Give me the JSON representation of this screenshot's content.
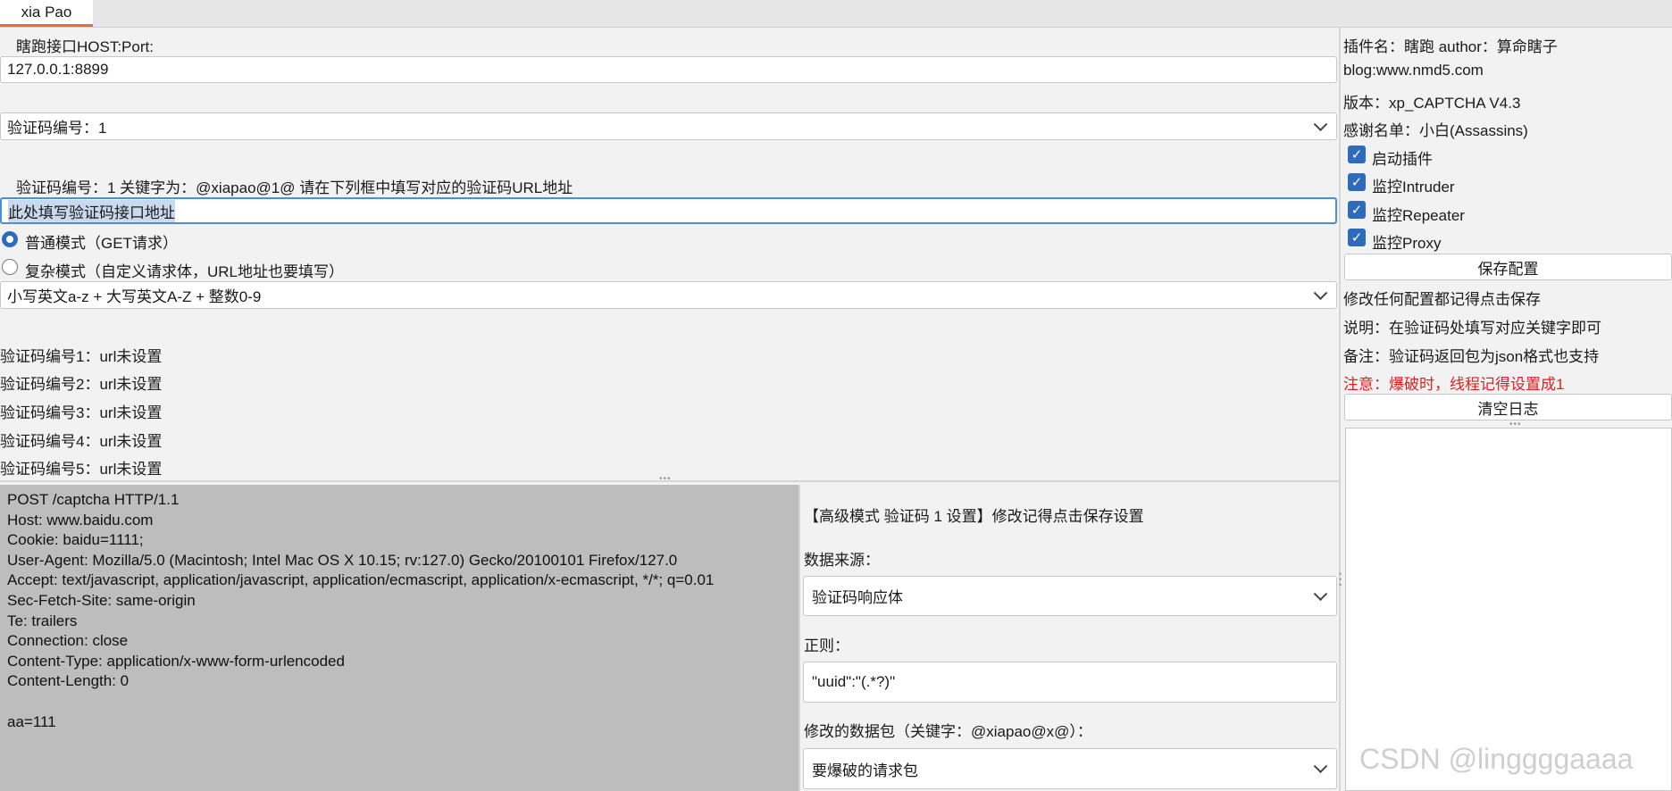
{
  "tab": {
    "label": "xia Pao"
  },
  "left": {
    "host_label": "瞎跑接口HOST:Port:",
    "host_value": "127.0.0.1:8899",
    "captcha_select": "验证码编号：1",
    "keyword_hint": "验证码编号：1  关键字为：@xiapao@1@     请在下列框中填写对应的验证码URL地址",
    "url_placeholder_value": "此处填写验证码接口地址",
    "radio_normal": "普通模式（GET请求）",
    "radio_complex": "复杂模式（自定义请求体，URL地址也要填写）",
    "charset_select": "小写英文a-z + 大写英文A-Z + 整数0-9",
    "status_list": [
      "验证码编号1：url未设置",
      "验证码编号2：url未设置",
      "验证码编号3：url未设置",
      "验证码编号4：url未设置",
      "验证码编号5：url未设置"
    ]
  },
  "request_editor": {
    "content": "POST /captcha HTTP/1.1\nHost: www.baidu.com\nCookie: baidu=1111;\nUser-Agent: Mozilla/5.0 (Macintosh; Intel Mac OS X 10.15; rv:127.0) Gecko/20100101 Firefox/127.0\nAccept: text/javascript, application/javascript, application/ecmascript, application/x-ecmascript, */*; q=0.01\nSec-Fetch-Site: same-origin\nTe: trailers\nConnection: close\nContent-Type: application/x-www-form-urlencoded\nContent-Length: 0\n\naa=111"
  },
  "advanced": {
    "title": "【高级模式 验证码 1 设置】修改记得点击保存设置",
    "source_label": "数据来源：",
    "source_select": "验证码响应体",
    "regex_label": "正则：",
    "regex_value": "\"uuid\":\"(.*?)\"",
    "packet_label": "修改的数据包（关键字：@xiapao@x@）：",
    "packet_select": "要爆破的请求包"
  },
  "right": {
    "plugin_info": "插件名：瞎跑 author：算命瞎子",
    "blog": "blog:www.nmd5.com",
    "version": "版本：xp_CAPTCHA V4.3",
    "thanks": "感谢名单：小白(Assassins)",
    "checkboxes": [
      "启动插件",
      "监控Intruder",
      "监控Repeater",
      "监控Proxy"
    ],
    "save_button": "保存配置",
    "save_hint": "修改任何配置都记得点击保存",
    "note1": "说明：在验证码处填写对应关键字即可",
    "note2": "备注：验证码返回包为json格式也支持",
    "warning": "注意：爆破时，线程记得设置成1",
    "clear_button": "清空日志",
    "warning_color": "#e02020"
  },
  "watermark": "CSDN @linggggaaaa",
  "accent_color": "#2f6bbd",
  "tab_accent": "#e9693b"
}
